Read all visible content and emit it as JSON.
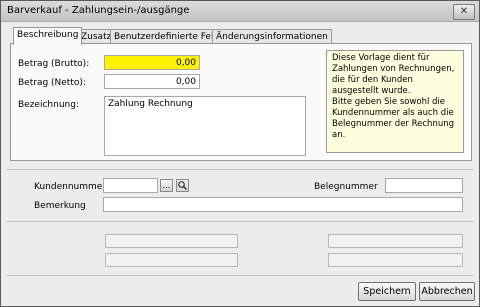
{
  "window": {
    "title": "Barverkauf - Zahlungsein-/ausgänge",
    "close": "✕"
  },
  "tabs": [
    "Beschreibung",
    "Zusatz",
    "Benutzerdefinierte Felder",
    "Änderungsinformationen"
  ],
  "form": {
    "brutto_label": "Betrag (Brutto):",
    "brutto_value": "0,00",
    "netto_label": "Betrag (Netto):",
    "netto_value": "0,00",
    "bezeichnung_label": "Bezeichnung:",
    "bezeichnung_value": "Zahlung Rechnung",
    "info": "Diese Vorlage dient für Zahlungen von Rechnungen, die für den Kunden ausgestellt wurde.\nBitte geben Sie sowohl die Kundennummer als auch die Belegnummer der Rechnung an.",
    "kunde_label": "Kundennummer",
    "kunde_value": "",
    "browse_btn": "...",
    "search_icon": "search-icon",
    "beleg_label": "Belegnummer",
    "beleg_value": "",
    "bemerkung_label": "Bemerkung",
    "bemerkung_value": ""
  },
  "buttons": {
    "save": "Speichern",
    "cancel": "Abbrechen"
  },
  "colors": {
    "highlight": "#fef200",
    "info_bg": "#ffffe0"
  }
}
